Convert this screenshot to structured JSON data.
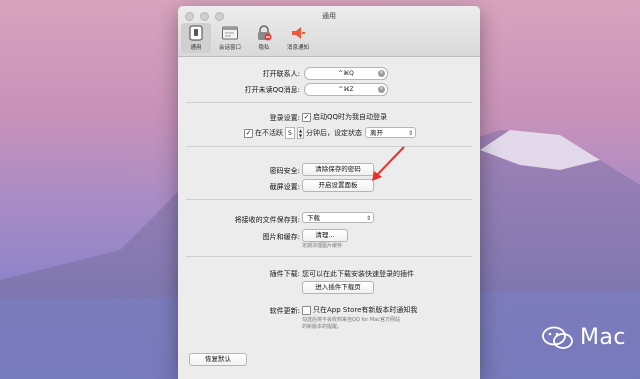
{
  "window": {
    "title": "通用"
  },
  "toolbar": [
    {
      "label": "通用",
      "icon": "phone-switch-icon"
    },
    {
      "label": "会话窗口",
      "icon": "chat-window-icon"
    },
    {
      "label": "隐私",
      "icon": "privacy-lock-icon"
    },
    {
      "label": "消息通知",
      "icon": "notification-speaker-icon"
    }
  ],
  "hotkeys": {
    "open_contacts_label": "打开联系人:",
    "open_contacts_value": "^⌘Q",
    "open_unread_label": "打开未读QQ消息:",
    "open_unread_value": "^⌘Z",
    "clear": "×"
  },
  "login": {
    "label": "登录设置:",
    "auto_login_check": "✓",
    "auto_login_text": "启动QQ时为我自动登录",
    "away_check": "✓",
    "away_prefix": "在不活跃",
    "away_minutes": "5",
    "away_suffix": "分钟后，设定状态",
    "away_status": "离开"
  },
  "security": {
    "password_label": "密码安全:",
    "password_button": "清除保存的密码",
    "screenshot_label": "截屏设置:",
    "screenshot_button": "开启设置面板"
  },
  "storage": {
    "save_to_label": "将接收的文件保存到:",
    "save_to_value": "下载",
    "images_label": "图片和缓存:",
    "clean_button": "清理...",
    "clean_hint": "定期清理图片缓存"
  },
  "plugins": {
    "label": "插件下载:",
    "text": "您可以在此下载安装快速登录的插件",
    "button": "进入插件下载页"
  },
  "updates": {
    "label": "软件更新:",
    "check_text": "只在App Store有新版本时通知我",
    "hint_line1": "勾选后将不会收到来自QQ for Mac官方网站",
    "hint_line2": "的新版本的提醒。"
  },
  "footer": {
    "restore_button": "恢复默认"
  },
  "watermark": {
    "text": "Mac"
  }
}
